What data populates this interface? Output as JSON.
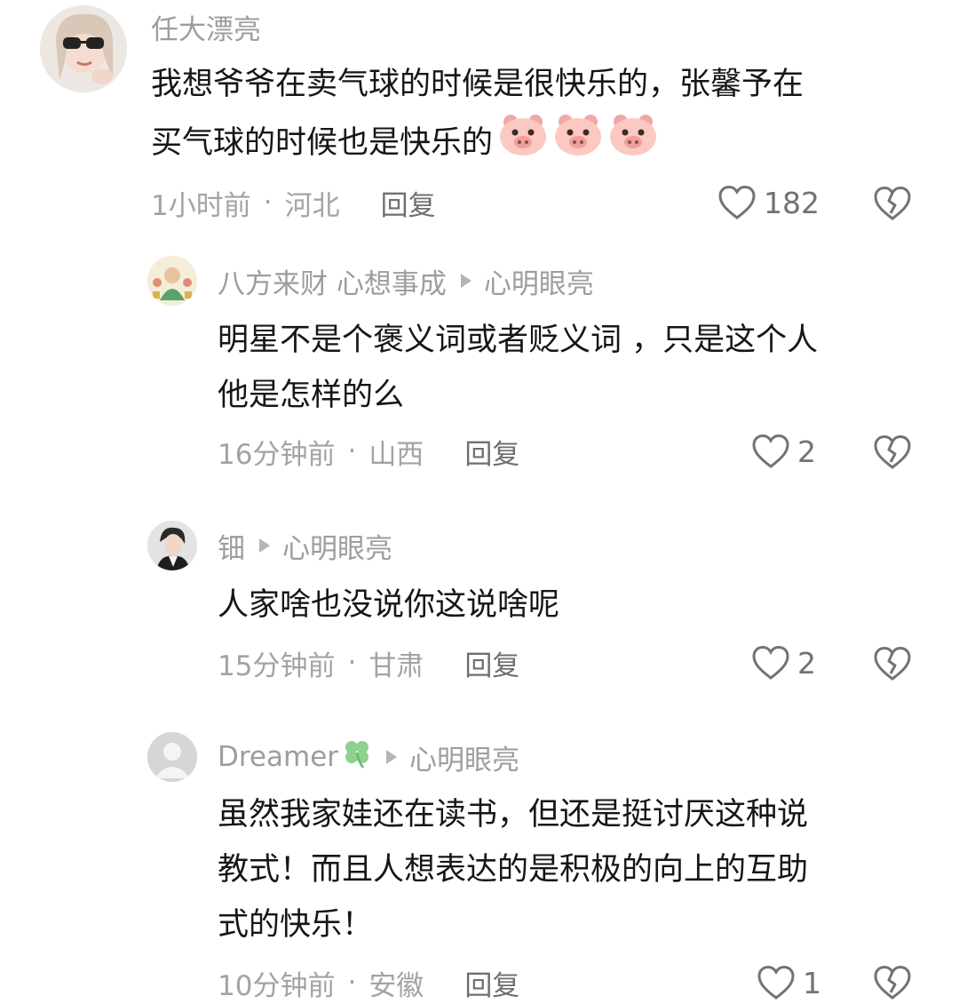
{
  "comments": [
    {
      "author": "任大漂亮",
      "text_lines": [
        "我想爷爷在卖气球的时候是很快乐的，张馨予在",
        "买气球的时候也是快乐的"
      ],
      "emoji_name": "pig-face-emoji",
      "emoji_count": 3,
      "time": "1小时前",
      "location": "河北",
      "reply_label": "回复",
      "likes": "182"
    },
    {
      "author": "八方来财 心想事成",
      "reply_to": "心明眼亮",
      "text_lines": [
        "明星不是个褒义词或者贬义词 ，只是这个人",
        "他是怎样的么"
      ],
      "time": "16分钟前",
      "location": "山西",
      "reply_label": "回复",
      "likes": "2"
    },
    {
      "author": "钿",
      "reply_to": "心明眼亮",
      "text_lines": [
        "人家啥也没说你这说啥呢"
      ],
      "time": "15分钟前",
      "location": "甘肃",
      "reply_label": "回复",
      "likes": "2"
    },
    {
      "author": "Dreamer",
      "author_icon": "four-leaf-clover-icon",
      "reply_to": "心明眼亮",
      "text_lines": [
        "虽然我家娃还在读书，但还是挺讨厌这种说",
        "教式！而且人想表达的是积极的向上的互助",
        "式的快乐！"
      ],
      "time": "10分钟前",
      "location": "安徽",
      "reply_label": "回复",
      "likes": "1"
    }
  ],
  "separator": "·",
  "icons": {
    "like": "heart-outline-icon",
    "dislike": "broken-heart-icon"
  },
  "colors": {
    "text": "#161616",
    "secondary": "#9d9d9d",
    "icon": "#737373"
  }
}
